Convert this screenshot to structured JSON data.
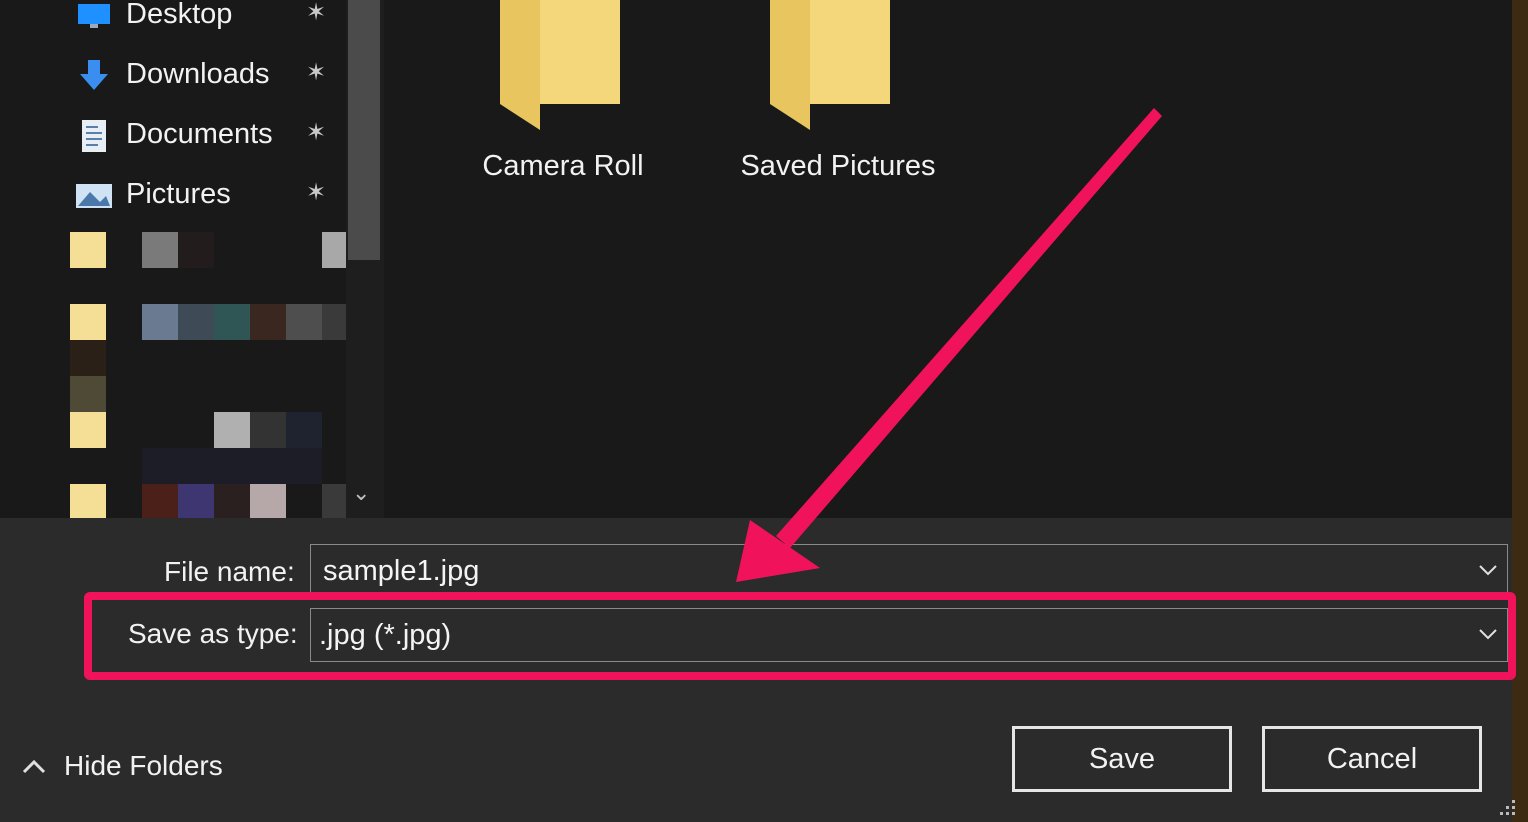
{
  "nav": {
    "items": [
      {
        "label": "Desktop",
        "icon": "desktop-icon"
      },
      {
        "label": "Downloads",
        "icon": "download-icon"
      },
      {
        "label": "Documents",
        "icon": "documents-icon"
      },
      {
        "label": "Pictures",
        "icon": "pictures-icon"
      }
    ],
    "pin_glyph": "📌"
  },
  "content": {
    "folders": [
      {
        "label": "Camera Roll"
      },
      {
        "label": "Saved Pictures"
      }
    ]
  },
  "form": {
    "file_name_label": "File name:",
    "file_name_value": "sample1.jpg",
    "save_type_label": "Save as type:",
    "save_type_value": ".jpg (*.jpg)"
  },
  "buttons": {
    "save": "Save",
    "cancel": "Cancel",
    "hide_folders": "Hide Folders"
  },
  "colors": {
    "annotation": "#f0135c",
    "background": "#191919",
    "panel": "#2b2b2b",
    "folder": "#f4d77a"
  }
}
